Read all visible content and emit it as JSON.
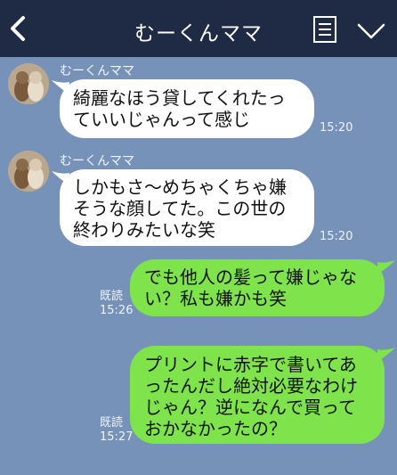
{
  "header": {
    "title": "むーくんママ",
    "back_icon": "chevron-left-icon",
    "menu_icon": "list-icon",
    "expand_icon": "chevron-down-icon"
  },
  "colors": {
    "header_bg": "#1f2a44",
    "chat_bg": "#7792b9",
    "incoming_bubble": "#ffffff",
    "outgoing_bubble": "#7fe34c"
  },
  "messages": [
    {
      "direction": "incoming",
      "sender": "むーくんママ",
      "text": "綺麗なほう貸してくれたっ\nていいじゃんって感じ",
      "time": "15:20"
    },
    {
      "direction": "incoming",
      "sender": "むーくんママ",
      "text": "しかもさ〜めちゃくちゃ嫌\nそうな顔してた。この世の\n終わりみたいな笑",
      "time": "15:20"
    },
    {
      "direction": "outgoing",
      "read": "既読",
      "text": "でも他人の髪って嫌じゃな\nい？私も嫌かも笑",
      "time": "15:26"
    },
    {
      "direction": "outgoing",
      "read": "既読",
      "text": "プリントに赤字で書いてあ\nったんだし絶対必要なわけ\nじゃん？逆になんで買って\nおかなかったの？",
      "time": "15:27"
    }
  ]
}
